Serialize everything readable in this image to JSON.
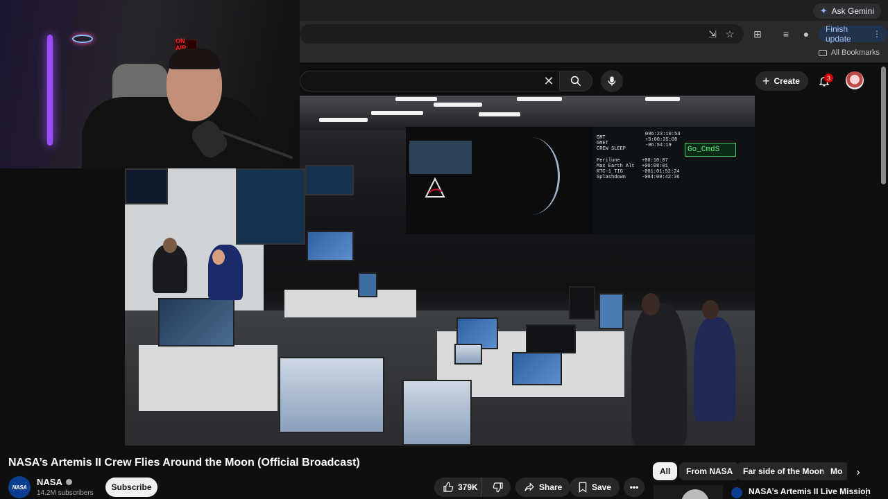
{
  "browser": {
    "gemini_label": "Ask Gemini",
    "finish_update_label": "Finish update",
    "all_bookmarks_label": "All Bookmarks"
  },
  "header": {
    "create_label": "Create",
    "notification_count": "3"
  },
  "webcam": {
    "on_air_label": "ON AIR"
  },
  "video": {
    "title": "NASA’s Artemis II Crew Flies Around the Moon (Official Broadcast)",
    "wall_text": {
      "clock_labels": "GMT\nGMET\nCREW SLEEP",
      "clock_values": "096:23:10:53\n+5:00:35:08\n-06:54:19",
      "trajectory_labels": "Perilune\nMax Earth Alt\nRTC-1 TIG\nSplashdown",
      "trajectory_values": "+00:10:07\n+00:08:01\n-001:01:52:24\n-004:00:42:36",
      "go_label": "Go_CmdS"
    }
  },
  "channel": {
    "name": "NASA",
    "subscribers": "14.2M subscribers",
    "avatar_text": "NASA",
    "subscribe_label": "Subscribe"
  },
  "actions": {
    "like_count": "379K",
    "share_label": "Share",
    "save_label": "Save"
  },
  "chips": [
    "All",
    "From NASA",
    "Far side of the Moon",
    "Mo"
  ],
  "recommendation": {
    "title": "NASA’s Artemis II Live Mission"
  },
  "colors": {
    "background": "#0f0f0f",
    "accent_neon": "#9a4dff",
    "notification_badge": "#cc0000",
    "go_status": "#5ef07e"
  }
}
